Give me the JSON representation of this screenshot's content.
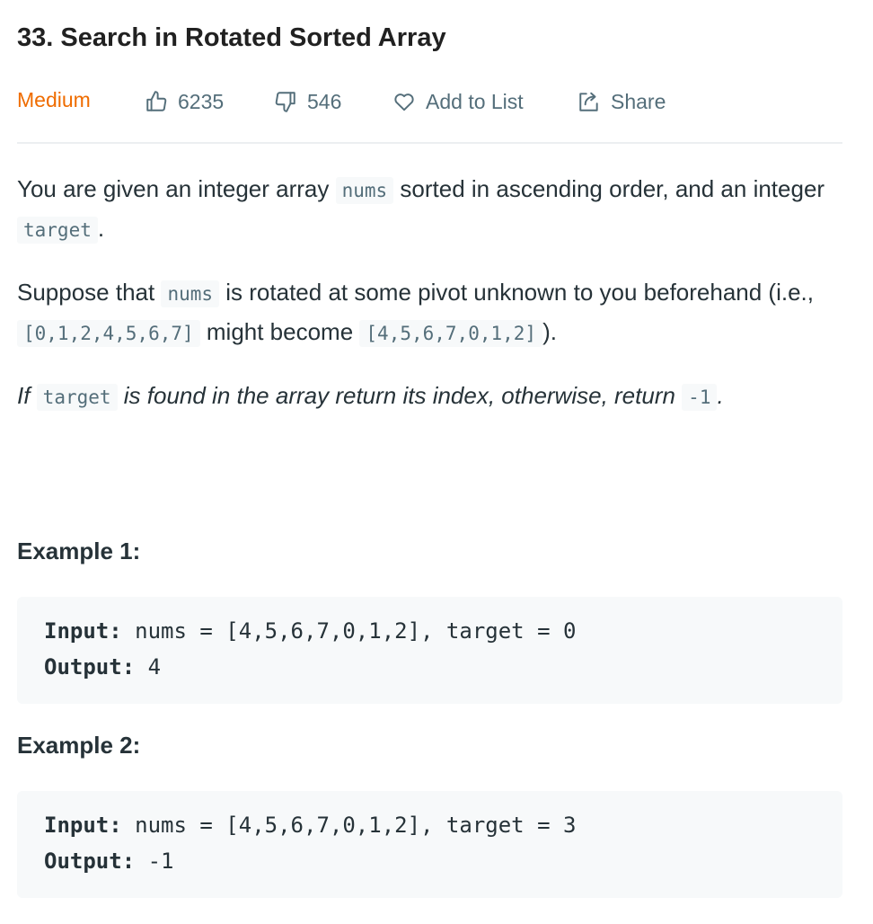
{
  "problem": {
    "title": "33. Search in Rotated Sorted Array",
    "difficulty": "Medium",
    "likes": "6235",
    "dislikes": "546",
    "add_to_list": "Add to List",
    "share": "Share"
  },
  "colors": {
    "difficulty": "#ef6c00",
    "meta_text": "#546e7a",
    "code_bg": "#f7f9fa"
  },
  "icons": {
    "likes": "thumbs-up-icon",
    "dislikes": "thumbs-down-icon",
    "add_to_list": "heart-icon",
    "share": "share-icon"
  },
  "description": {
    "p1": {
      "t1": "You are given an integer array ",
      "c1": "nums",
      "t2": " sorted in ascending order, and an integer ",
      "c2": "target",
      "t3": "."
    },
    "p2": {
      "t1": "Suppose that ",
      "c1": "nums",
      "t2": " is rotated at some pivot unknown to you beforehand (i.e., ",
      "c2": "[0,1,2,4,5,6,7]",
      "t3": " might become ",
      "c3": "[4,5,6,7,0,1,2]",
      "t4": ")."
    },
    "p3": {
      "t1": "If ",
      "c1": "target",
      "t2": " is found in the array return its index, otherwise, return ",
      "c2": "-1",
      "t3": "."
    }
  },
  "examples": [
    {
      "title": "Example 1:",
      "input_label": "Input:",
      "input": " nums = [4,5,6,7,0,1,2], target = 0",
      "output_label": "Output:",
      "output": " 4"
    },
    {
      "title": "Example 2:",
      "input_label": "Input:",
      "input": " nums = [4,5,6,7,0,1,2], target = 3",
      "output_label": "Output:",
      "output": " -1"
    }
  ]
}
